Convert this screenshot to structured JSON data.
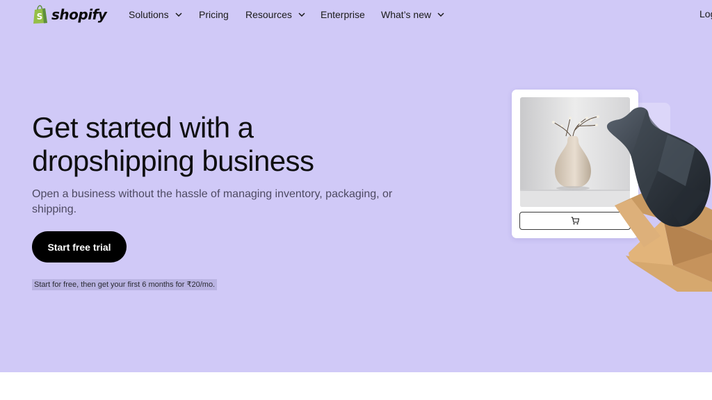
{
  "nav": {
    "logo_text": "shopify",
    "items": [
      {
        "label": "Solutions",
        "dropdown": true
      },
      {
        "label": "Pricing",
        "dropdown": false
      },
      {
        "label": "Resources",
        "dropdown": true
      },
      {
        "label": "Enterprise",
        "dropdown": false
      },
      {
        "label": "What’s new",
        "dropdown": true
      }
    ],
    "login_label": "Log"
  },
  "hero": {
    "headline_line1": "Get started with a",
    "headline_line2": "dropshipping business",
    "subhead": "Open a business without the hassle of managing inventory, packaging, or shipping.",
    "cta_label": "Start free trial",
    "note": "Start for free, then get your first 6 months for ₹20/mo."
  },
  "illustration": {
    "cart_icon": "shopping-cart-icon",
    "logo_icon": "shopping-bag-icon"
  },
  "colors": {
    "hero_background": "#d0c9f7",
    "cta_background": "#000000",
    "brand_green": "#95bf47",
    "note_highlight": "#b9b3e2"
  }
}
